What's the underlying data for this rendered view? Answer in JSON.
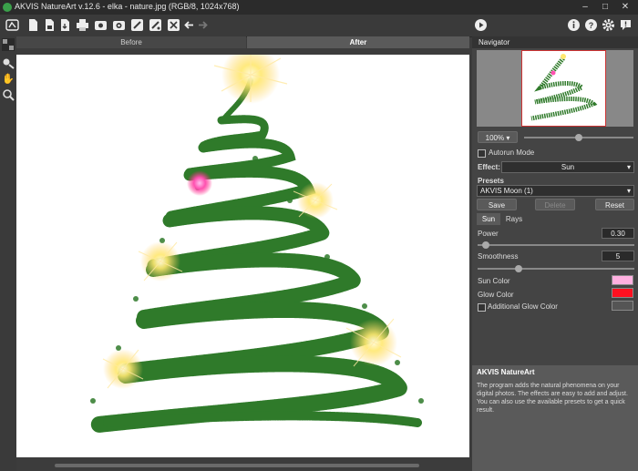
{
  "window": {
    "title": "AKVIS NatureArt v.12.6 - elka - nature.jpg (RGB/8, 1024x768)"
  },
  "canvas_tabs": {
    "before": "Before",
    "after": "After"
  },
  "navigator": {
    "title": "Navigator",
    "zoom": "100%"
  },
  "autorun": {
    "label": "Autorun Mode",
    "checked": false
  },
  "effect": {
    "label": "Effect:",
    "value": "Sun"
  },
  "presets": {
    "label": "Presets",
    "value": "AKVIS Moon (1)",
    "save": "Save",
    "delete": "Delete",
    "reset": "Reset"
  },
  "subtabs": {
    "sun": "Sun",
    "rays": "Rays"
  },
  "params": {
    "power": {
      "label": "Power",
      "value": "0.30",
      "fraction": 0.03
    },
    "smoothness": {
      "label": "Smoothness",
      "value": "5",
      "fraction": 0.25
    }
  },
  "colors": {
    "sun_color": {
      "label": "Sun Color",
      "hex": "#ffb0e0"
    },
    "glow_color": {
      "label": "Glow Color",
      "hex": "#ff1020"
    },
    "additional_glow": {
      "label": "Additional Glow Color",
      "checked": false,
      "hex": "#555555"
    }
  },
  "help": {
    "title": "AKVIS NatureArt",
    "body": "The program adds the natural phenomena on your digital photos. The effects are easy to add and adjust. You can also use the available presets to get a quick result."
  },
  "icons": {
    "toolbar": [
      "home-icon",
      "open-icon",
      "save-icon",
      "export-icon",
      "print-icon",
      "batch-icon",
      "share-icon",
      "brush-icon",
      "settings-brush-icon",
      "preferences-icon",
      "undo-icon",
      "redo-icon",
      "run-icon",
      "info-icon",
      "help-icon",
      "gear-icon",
      "notification-icon"
    ]
  }
}
